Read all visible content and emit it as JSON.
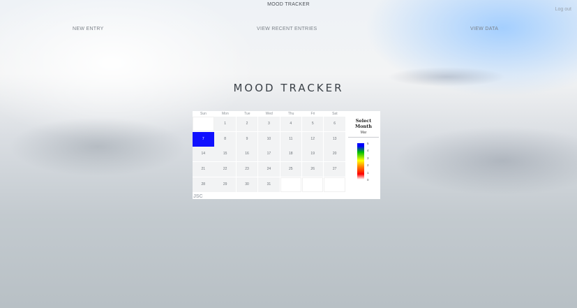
{
  "header": {
    "title": "MOOD TRACKER",
    "logout_label": "Log out"
  },
  "nav": {
    "new_entry": "NEW ENTRY",
    "recent_entries": "VIEW RECENT ENTRIES",
    "view_data": "VIEW DATA"
  },
  "hero": {
    "title": "MOOD TRACKER"
  },
  "calendar": {
    "weekdays": [
      "Sun",
      "Mon",
      "Tue",
      "Wed",
      "Thu",
      "Fri",
      "Sat"
    ],
    "weeks": [
      [
        "",
        "1",
        "2",
        "3",
        "4",
        "5",
        "6"
      ],
      [
        "7",
        "8",
        "9",
        "10",
        "11",
        "12",
        "13"
      ],
      [
        "14",
        "15",
        "16",
        "17",
        "18",
        "19",
        "20"
      ],
      [
        "21",
        "22",
        "23",
        "24",
        "25",
        "26",
        "27"
      ],
      [
        "28",
        "29",
        "30",
        "31",
        "",
        "",
        ""
      ]
    ],
    "selected_day": "7",
    "selected_color": "#1010ff",
    "brand_mark": "JSC"
  },
  "side_panel": {
    "title": "Select Month",
    "month": "Mar"
  },
  "legend": {
    "ticks": [
      "5",
      "4",
      "3",
      "2",
      "1",
      "0"
    ],
    "colors": [
      "#0000ff",
      "#00c000",
      "#ffff00",
      "#ff8000",
      "#ff0000",
      "#ffffff"
    ]
  }
}
